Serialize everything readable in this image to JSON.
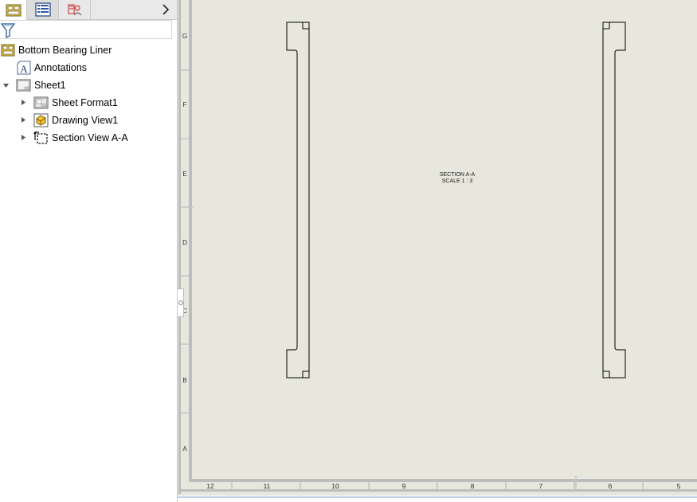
{
  "feature_tree": {
    "filter_placeholder": "",
    "items": [
      {
        "label": "Bottom Bearing Liner",
        "icon": "drawing-document-icon"
      },
      {
        "label": "Annotations",
        "icon": "annotations-icon"
      },
      {
        "label": "Sheet1",
        "icon": "sheet-icon"
      },
      {
        "label": "Sheet Format1",
        "icon": "sheet-format-icon"
      },
      {
        "label": "Drawing View1",
        "icon": "drawing-view-icon"
      },
      {
        "label": "Section View A-A",
        "icon": "section-view-icon"
      }
    ]
  },
  "tabs": [
    {
      "name": "featuremanager-tab",
      "icon": "feature-manager-icon"
    },
    {
      "name": "propertymanager-tab",
      "icon": "property-manager-icon"
    },
    {
      "name": "configuration-tab",
      "icon": "display-manager-icon"
    }
  ],
  "drawing": {
    "section_label": "SECTION A-A",
    "scale_label": "SCALE 1 : 3",
    "zone_rows": [
      "G",
      "F",
      "E",
      "D",
      "C",
      "B",
      "A"
    ],
    "zone_columns": [
      "12",
      "11",
      "10",
      "9",
      "8",
      "7",
      "6",
      "5"
    ]
  },
  "colors": {
    "sheet_background": "#e7e7dd",
    "border_gray": "#bdbdbd",
    "outline": "#000000"
  }
}
